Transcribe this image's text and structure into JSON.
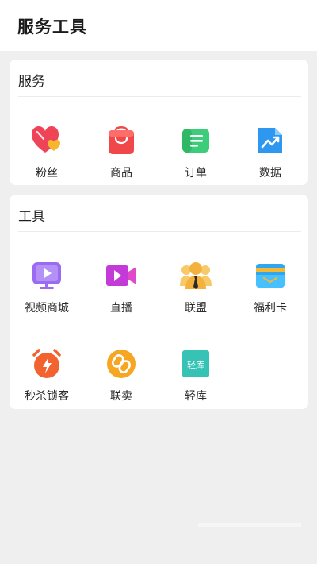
{
  "header": {
    "title": "服务工具"
  },
  "services": {
    "title": "服务",
    "items": [
      {
        "label": "粉丝",
        "icon": "heart-fans-icon"
      },
      {
        "label": "商品",
        "icon": "shopping-bag-icon"
      },
      {
        "label": "订单",
        "icon": "order-note-icon"
      },
      {
        "label": "数据",
        "icon": "data-chart-icon"
      }
    ]
  },
  "tools": {
    "title": "工具",
    "items": [
      {
        "label": "视频商城",
        "icon": "video-tv-icon"
      },
      {
        "label": "直播",
        "icon": "live-camera-icon"
      },
      {
        "label": "联盟",
        "icon": "alliance-people-icon"
      },
      {
        "label": "福利卡",
        "icon": "welfare-card-icon"
      },
      {
        "label": "秒杀锁客",
        "icon": "flash-sale-alarm-icon"
      },
      {
        "label": "联卖",
        "icon": "link-sell-icon"
      },
      {
        "label": "轻库",
        "icon": "light-store-icon",
        "icon_text": "轻库"
      }
    ]
  },
  "colors": {
    "background": "#efefef",
    "card": "#ffffff",
    "heart": "#ef4358",
    "bag": "#f0474b",
    "order": "#3ccc7a",
    "data": "#2e97f0",
    "video": "#9b6cf2",
    "live": "#c43ad8",
    "alliance": "#f4b13c",
    "card_icon": "#2fa6f0",
    "alarm": "#f2632f",
    "linksell": "#f6a623",
    "store": "#36c2b4"
  }
}
